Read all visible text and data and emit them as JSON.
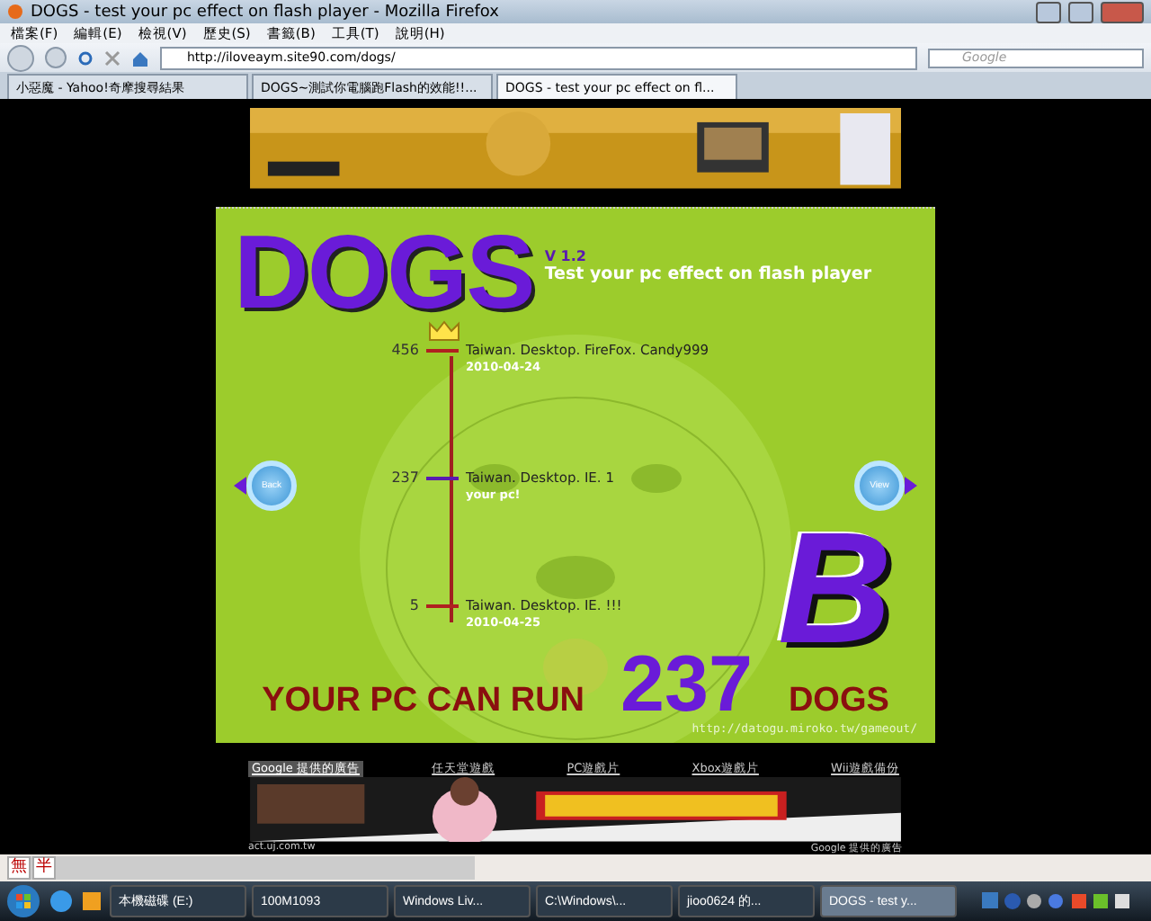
{
  "window": {
    "title": "DOGS - test your pc effect on flash player - Mozilla Firefox"
  },
  "menu": [
    "檔案(F)",
    "編輯(E)",
    "檢視(V)",
    "歷史(S)",
    "書籤(B)",
    "工具(T)",
    "說明(H)"
  ],
  "address": {
    "url": "http://iloveaym.site90.com/dogs/"
  },
  "search": {
    "placeholder": "Google"
  },
  "tabs": [
    {
      "label": "小惡魔 - Yahoo!奇摩搜尋結果",
      "selected": false
    },
    {
      "label": "DOGS~測試你電腦跑Flash的效能!!...",
      "selected": false
    },
    {
      "label": "DOGS - test your pc effect on fl...",
      "selected": true
    }
  ],
  "game": {
    "logo": "DOGS",
    "version": "V 1.2",
    "subtitle": "Test your pc effect on flash player",
    "records": [
      {
        "score": "456",
        "name": "Taiwan. Desktop. FireFox. Candy999",
        "note": "2010-04-24",
        "crown": true,
        "current": false
      },
      {
        "score": "237",
        "name": "Taiwan. Desktop. IE. 1",
        "note": "your pc!",
        "crown": false,
        "current": true
      },
      {
        "score": "5",
        "name": "Taiwan. Desktop. IE. !!!",
        "note": "2010-04-25",
        "crown": false,
        "current": false
      }
    ],
    "back": "Back",
    "view": "View",
    "grade": "B",
    "result_prefix": "YOUR PC CAN RUN",
    "result_score": "237",
    "result_suffix": "DOGS",
    "credit": "http://datogu.miroko.tw/gameout/"
  },
  "ad_links": [
    {
      "label": "Google 提供的廣告",
      "selected": true
    },
    {
      "label": "任天堂遊戲",
      "selected": false
    },
    {
      "label": "PC遊戲片",
      "selected": false
    },
    {
      "label": "Xbox遊戲片",
      "selected": false
    },
    {
      "label": "Wii遊戲備份",
      "selected": false
    }
  ],
  "ad_footer": {
    "left": "act.uj.com.tw",
    "right": "Google 提供的廣告"
  },
  "ime": [
    "無",
    "半"
  ],
  "taskbar": [
    {
      "label": "本機磁碟 (E:)",
      "selected": false
    },
    {
      "label": "100M1093",
      "selected": false
    },
    {
      "label": "Windows Liv...",
      "selected": false
    },
    {
      "label": "C:\\Windows\\...",
      "selected": false
    },
    {
      "label": "jioo0624 的...",
      "selected": false
    },
    {
      "label": "DOGS - test y...",
      "selected": true
    }
  ]
}
